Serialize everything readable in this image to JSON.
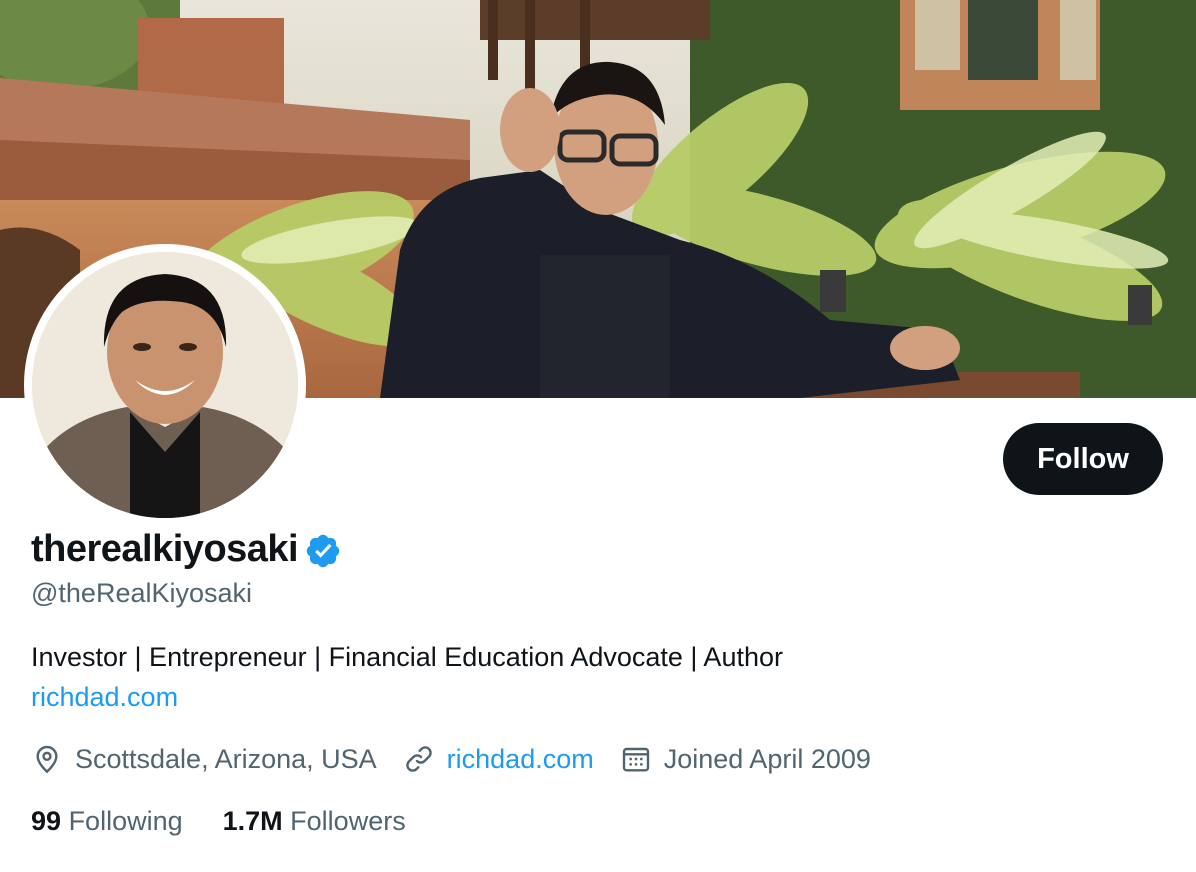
{
  "profile": {
    "display_name": "therealkiyosaki",
    "handle": "@theRealKiyosaki",
    "bio": "Investor | Entrepreneur | Financial Education Advocate | Author",
    "bio_link": "richdad.com",
    "verified": true
  },
  "meta": {
    "location": "Scottsdale, Arizona, USA",
    "website": "richdad.com",
    "joined": "Joined April 2009"
  },
  "stats": {
    "following_count": "99",
    "following_label": "Following",
    "followers_count": "1.7M",
    "followers_label": "Followers"
  },
  "actions": {
    "follow_label": "Follow"
  },
  "icons": {
    "verified": "verified-badge-icon",
    "location": "location-pin-icon",
    "website": "link-icon",
    "joined": "calendar-icon"
  },
  "colors": {
    "accent": "#1d9bf0",
    "text_primary": "#0f1419",
    "text_secondary": "#536471",
    "button_bg": "#0f1419"
  }
}
